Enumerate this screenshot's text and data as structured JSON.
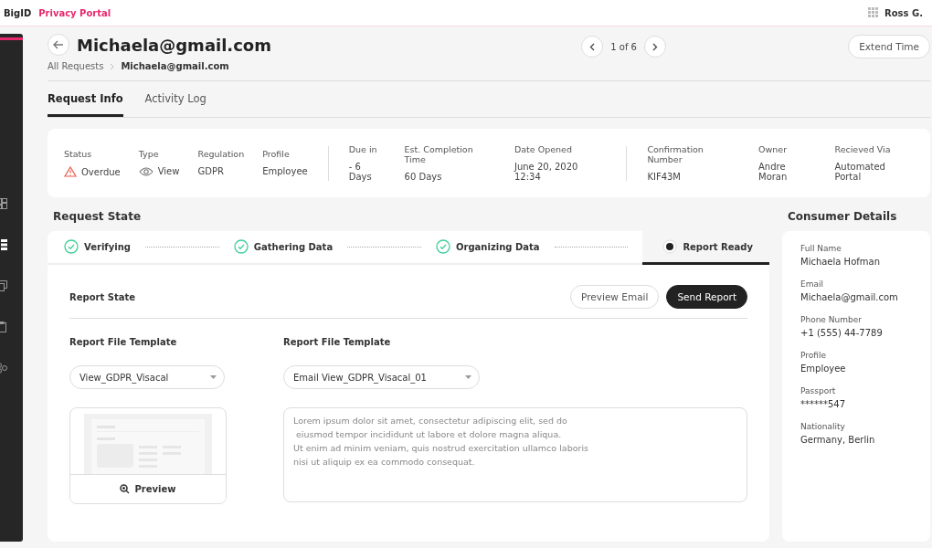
{
  "header": {
    "logo": "BigID",
    "product": "Privacy Portal",
    "user": "Ross G."
  },
  "sidebar": {
    "items": [
      {
        "selected": false
      },
      {
        "selected": true
      },
      {
        "selected": false
      },
      {
        "selected": false
      },
      {
        "selected": false
      }
    ]
  },
  "title": "Michaela@gmail.com",
  "breadcrumb": [
    "All Requests",
    "Michaela@gmail.com"
  ],
  "pager": "1 of 6",
  "extend_button": "Extend Time",
  "tabs": [
    {
      "label": "Request Info",
      "selected": true
    },
    {
      "label": "Activity Log",
      "selected": false
    }
  ],
  "info_groups": [
    [
      {
        "label": "Status",
        "value": "Overdue",
        "kind": "warning"
      },
      {
        "label": "Type",
        "value": "View",
        "kind": "eye"
      },
      {
        "label": "Regulation",
        "value": "GDPR",
        "kind": "plain"
      },
      {
        "label": "Profile",
        "value": "Employee",
        "kind": "plain"
      }
    ],
    [
      {
        "label": "Due in",
        "value": "- 6 Days",
        "kind": "plain"
      },
      {
        "label": "Est. Completion Time",
        "value": "60 Days",
        "kind": "plain"
      },
      {
        "label": "Date Opened",
        "value": "June 20, 2020 12:34",
        "kind": "plain"
      }
    ],
    [
      {
        "label": "Confirmation Number",
        "value": "KIF43M",
        "kind": "plain"
      },
      {
        "label": "Owner",
        "value": "Andre Moran",
        "kind": "plain"
      },
      {
        "label": "Recieved Via",
        "value": "Automated Portal",
        "kind": "plain"
      }
    ]
  ],
  "request_state": {
    "title": "Request State",
    "steps": [
      {
        "label": "Verifying",
        "done": true,
        "selected": false
      },
      {
        "label": "Gathering Data",
        "done": true,
        "selected": false
      },
      {
        "label": "Organizing Data",
        "done": true,
        "selected": false
      },
      {
        "label": "Report Ready",
        "done": false,
        "selected": true
      }
    ],
    "report_state": "Report State",
    "buttons": [
      {
        "label": "Preview Email",
        "kind": "outline"
      },
      {
        "label": "Send Report",
        "kind": "primary"
      }
    ],
    "file_template": {
      "label": "Report File Template",
      "value": "View_GDPR_Visacal",
      "preview_button": "Preview"
    },
    "email_template": {
      "label": "Report File Template",
      "value": "Email View_GDPR_Visacal_01",
      "body": [
        "Lorem ipsum dolor sit amet, consectetur adipiscing elit, sed do",
        " eiusmod tempor incididunt ut labore et dolore magna aliqua.",
        "Ut enim ad minim veniam, quis nostrud exercitation ullamco laboris",
        "nisi ut aliquip ex ea commodo consequat."
      ]
    }
  },
  "consumer": {
    "title": "Consumer Details",
    "fields": [
      {
        "label": "Full Name",
        "value": "Michaela Hofman"
      },
      {
        "label": "Email",
        "value": "Michaela@gmail.com"
      },
      {
        "label": "Phone Number",
        "value": "+1 (555) 44-7789"
      },
      {
        "label": "Profile",
        "value": "Employee"
      },
      {
        "label": "Passport",
        "value": "******547"
      },
      {
        "label": "Nationality",
        "value": "Germany, Berlin"
      }
    ]
  }
}
